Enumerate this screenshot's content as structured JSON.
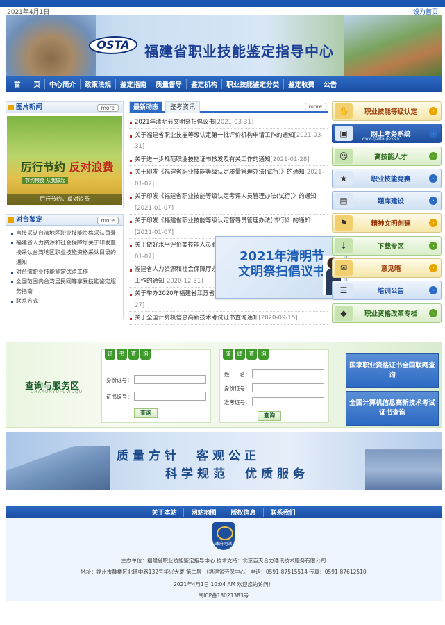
{
  "topbar": {
    "date": "2021年4月1日",
    "home": "设为首页"
  },
  "header": {
    "logo": "OSTA",
    "title": "福建省职业技能鉴定指导中心"
  },
  "nav": [
    "首　　页",
    "中心简介",
    "政策法规",
    "鉴定指南",
    "质量督导",
    "鉴定机构",
    "职业技能鉴定分类",
    "鉴定收费",
    "公告"
  ],
  "photo_news": {
    "title": "图片新闻",
    "more": "more",
    "slogan_a": "厉行节约",
    "slogan_b": "反对浪费",
    "tag": "节约粮食 从我做起",
    "caption": "厉行节约，反对浪费"
  },
  "check": {
    "title": "对台鉴定",
    "more": "more",
    "items": [
      "直接采认台湾地区职业技能资格采认目录",
      "福建省人力资源和社会保障厅关于印发直接采认台湾地区职业技能资格采认目录的通知",
      "对台湾职业技能鉴定试点工作",
      "全国范围内台湾居民同等享受技能鉴定服务指南",
      "联系方式"
    ]
  },
  "news": {
    "tabs": [
      "最新动态",
      "鉴考资讯"
    ],
    "more": "more",
    "items": [
      {
        "text": "2021年清明节文明祭扫倡议书",
        "date": "[2021-03-31]"
      },
      {
        "text": "关于福建省职业技能等级认定第一批评价机构申请工作的通知",
        "date": "[2021-03-31]"
      },
      {
        "text": "关于进一步规范职业技能证书核发及有关工作的通知",
        "date": "[2021-01-28]"
      },
      {
        "text": "关于印发《福建省职业技能等级认定质量管理办法(试行)》的通知",
        "date": "[2021-01-07]"
      },
      {
        "text": "关于印发《福建省职业技能等级认定考评人员管理办法(试行)》的通知",
        "date": "[2021-01-07]"
      },
      {
        "text": "关于印发《福建省职业技能等级认定督导员管理办法(试行)》的通知",
        "date": "[2021-01-07]"
      },
      {
        "text": "关于做好水平评价类技能人员职业资格退出目录后有关工作的通知",
        "date": "[2021-01-07]"
      },
      {
        "text": "福建省人力资源和社会保障厅办公室关于开展职业技能等级认定备案试点工作的通知",
        "date": "[2020-12-31]"
      },
      {
        "text": "关于举办2020年福建省江苏省等8个项目职业技能竞赛的通知",
        "date": "[2020-10-27]"
      },
      {
        "text": "关于全国计算机信息高新技术考试证书查询通知",
        "date": "[2020-09-15]"
      }
    ]
  },
  "popup": {
    "line1": "2021年清明节",
    "line2": "文明祭扫倡议书"
  },
  "quick_links": [
    {
      "label": "职业技能等级认定",
      "icon": "hand-icon",
      "style": "yellow"
    },
    {
      "label": "网上考务系统",
      "icon": "computer-icon",
      "style": "dark"
    },
    {
      "label": "高技能人才",
      "icon": "worker-icon",
      "style": "green"
    },
    {
      "label": "职业技能竞赛",
      "icon": "trophy-icon",
      "style": "blue"
    },
    {
      "label": "题库建设",
      "icon": "books-icon",
      "style": "blue"
    },
    {
      "label": "精神文明创建",
      "icon": "flag-icon",
      "style": "yellow"
    },
    {
      "label": "下载专区",
      "icon": "download-icon",
      "style": "green"
    },
    {
      "label": "意见箱",
      "icon": "mailbox-icon",
      "style": "yellow"
    },
    {
      "label": "培训公告",
      "icon": "notice-icon",
      "style": "blue"
    },
    {
      "label": "职业资格改革专栏",
      "icon": "column-icon",
      "style": "green"
    }
  ],
  "quick_sub": "www.fjosta.gov.cn",
  "service": {
    "title": "查询与服务区",
    "title_en": "CHAXUNYUFUWUQU",
    "cert_query": {
      "tab": [
        "证",
        "书",
        "查",
        "询"
      ],
      "id_label": "身份证号：",
      "cert_label": "证书编号：",
      "button": "查询"
    },
    "score_query": {
      "tab": [
        "成",
        "绩",
        "查",
        "询"
      ],
      "name_label": "姓　　名：",
      "id_label": "身份证号：",
      "ticket_label": "准考证号：",
      "button": "查询"
    },
    "links": [
      "国家职业资格证书全国联网查询",
      "全国计算机信息高新技术考试证书查询"
    ]
  },
  "quality": {
    "line1": "质量方针　客观公正",
    "line2": "科学规范　优质服务"
  },
  "footer_nav": [
    "关于本站",
    "网站地图",
    "版权信息",
    "联系我们"
  ],
  "footer": {
    "emblem": "政府网站",
    "sponsor": "主办单位：福建省职业技能鉴定指导中心 技术支持：北京百天合力通讯技术服务有限公司",
    "address": "地址：福州市鼓楼区北环中路132号华兴大厦 第二层 （福建省劳保中心）电话：0591-87515514 传真：0591-87612510",
    "time": "2021年4月1日 10:04 AM 欢迎您的访问！",
    "icp": "闽ICP备18021383号"
  }
}
